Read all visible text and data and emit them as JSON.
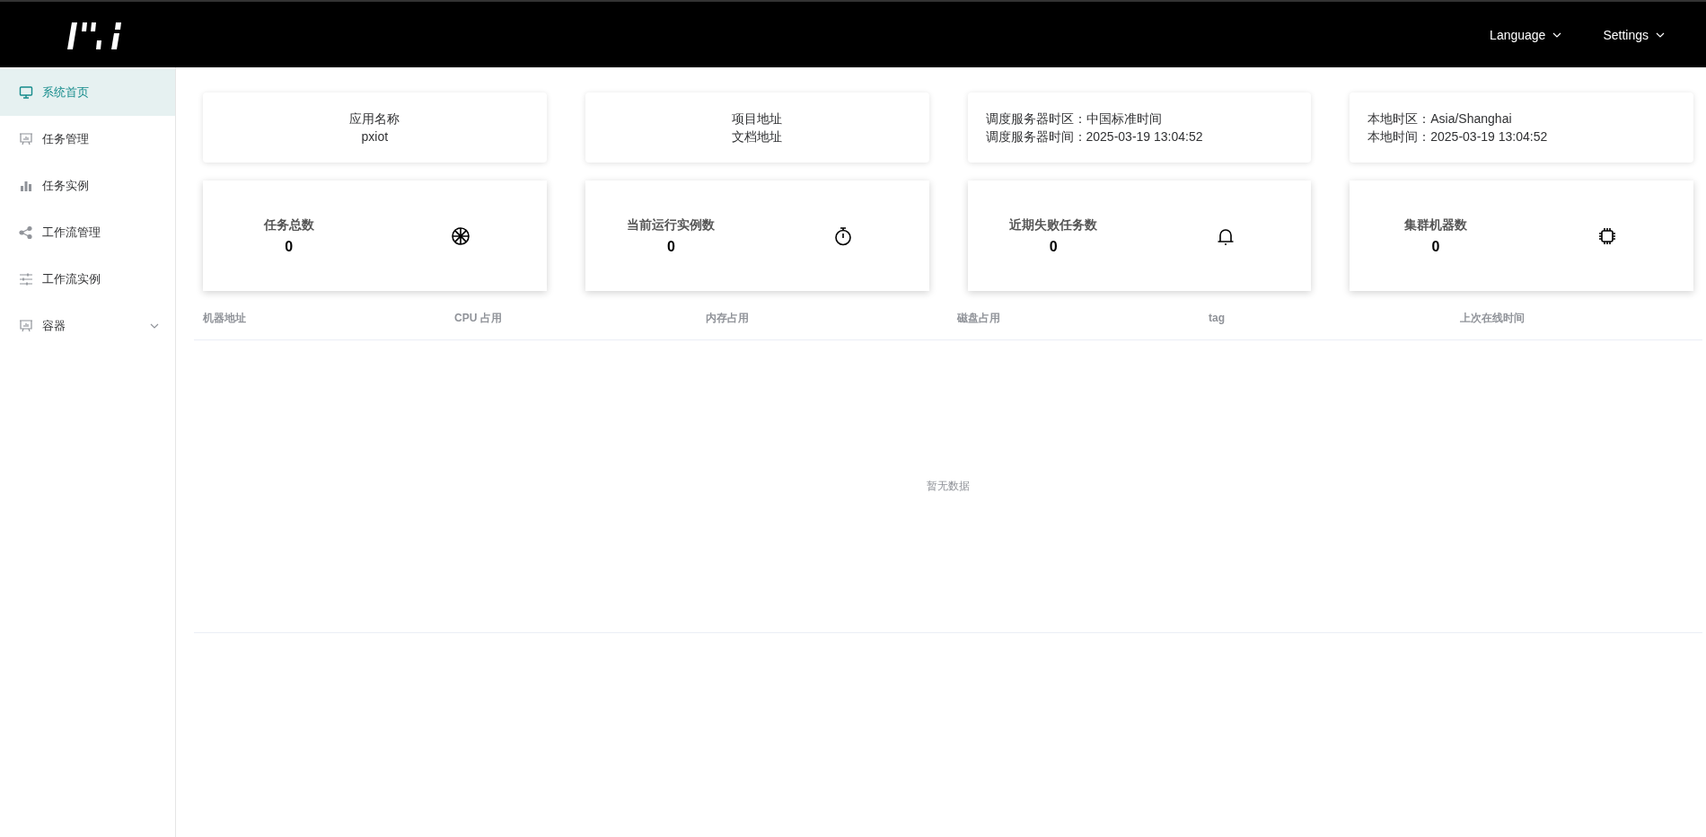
{
  "header": {
    "menus": [
      {
        "label": "Language"
      },
      {
        "label": "Settings"
      }
    ]
  },
  "sidebar": {
    "items": [
      {
        "label": "系统首页",
        "kind": "monitor",
        "selected": true
      },
      {
        "label": "任务管理",
        "kind": "board",
        "selected": false
      },
      {
        "label": "任务实例",
        "kind": "bars",
        "selected": false
      },
      {
        "label": "工作流管理",
        "kind": "share",
        "selected": false
      },
      {
        "label": "工作流实例",
        "kind": "sliders",
        "selected": false
      },
      {
        "label": "容器",
        "kind": "board",
        "selected": false,
        "expanded": false
      }
    ]
  },
  "info_cards": [
    {
      "kind": "centered",
      "lines": [
        "应用名称",
        "pxiot"
      ]
    },
    {
      "kind": "centered",
      "lines": [
        "项目地址",
        "文档地址"
      ]
    },
    {
      "kind": "left",
      "lines": [
        "调度服务器时区：中国标准时间",
        "调度服务器时间：2025-03-19 13:04:52"
      ]
    },
    {
      "kind": "left",
      "lines": [
        "本地时区：Asia/Shanghai",
        "本地时间：2025-03-19 13:04:52"
      ]
    }
  ],
  "stat_cards": [
    {
      "title": "任务总数",
      "value": "0",
      "kind": "wheel"
    },
    {
      "title": "当前运行实例数",
      "value": "0",
      "kind": "stopwatch"
    },
    {
      "title": "近期失败任务数",
      "value": "0",
      "kind": "bell"
    },
    {
      "title": "集群机器数",
      "value": "0",
      "kind": "chip"
    }
  ],
  "table": {
    "columns": [
      "机器地址",
      "CPU 占用",
      "内存占用",
      "磁盘占用",
      "tag",
      "上次在线时间"
    ],
    "empty_text": "暂无数据"
  }
}
